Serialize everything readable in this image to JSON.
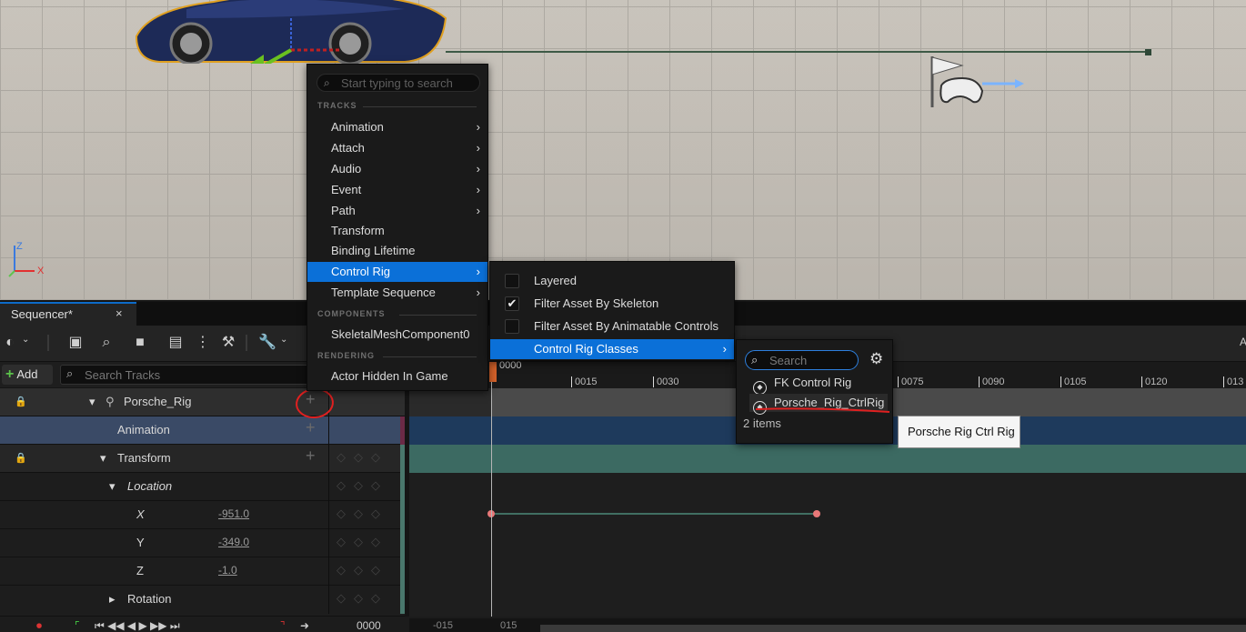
{
  "sequencer": {
    "tab_title": "Sequencer*",
    "close": "×",
    "add_label": "Add",
    "add_plus": "+",
    "search_placeholder": "Search Tracks",
    "more": "A"
  },
  "ruler": {
    "ticks": [
      "0015",
      "0030",
      "0075",
      "0090",
      "0105",
      "0120",
      "013"
    ],
    "playhead_label": "0000"
  },
  "outliner": {
    "rows": [
      {
        "label": "Porsche_Rig",
        "plus": "+"
      },
      {
        "label": "Animation",
        "plus": "+"
      },
      {
        "label": "Transform",
        "plus": "+"
      },
      {
        "label": "Location"
      },
      {
        "label": "X",
        "value": "-951.0"
      },
      {
        "label": "Y",
        "value": "-349.0"
      },
      {
        "label": "Z",
        "value": "-1.0"
      },
      {
        "label": "Rotation"
      }
    ]
  },
  "transport": {
    "time": "0000",
    "left_marker": "-015",
    "right_marker": "015"
  },
  "menu_tracks": {
    "search_placeholder": "Start typing to search",
    "section_tracks": "TRACKS",
    "items": [
      "Animation",
      "Attach",
      "Audio",
      "Event",
      "Path",
      "Transform",
      "Binding Lifetime",
      "Control Rig",
      "Template Sequence"
    ],
    "section_components": "COMPONENTS",
    "component_item": "SkeletalMeshComponent0",
    "section_rendering": "RENDERING",
    "rendering_item": "Actor Hidden In Game"
  },
  "menu_control_rig": {
    "items": [
      {
        "label": "Layered",
        "checked": false
      },
      {
        "label": "Filter Asset By Skeleton",
        "checked": true
      },
      {
        "label": "Filter Asset By Animatable Controls",
        "checked": false
      }
    ],
    "classes_label": "Control Rig Classes",
    "check_glyph": "✔"
  },
  "menu_classes": {
    "search_placeholder": "Search",
    "items": [
      "FK Control Rig",
      "Porsche_Rig_CtrlRig"
    ],
    "count": "2 items"
  },
  "tooltip": {
    "text": "Porsche Rig Ctrl Rig"
  },
  "viewport": {
    "axis_z": "Z",
    "axis_x": "X"
  },
  "colors": {
    "accent": "#0b70d8",
    "track_teal": "#49776c",
    "playhead": "#d2612a",
    "annotation": "#e02020"
  }
}
